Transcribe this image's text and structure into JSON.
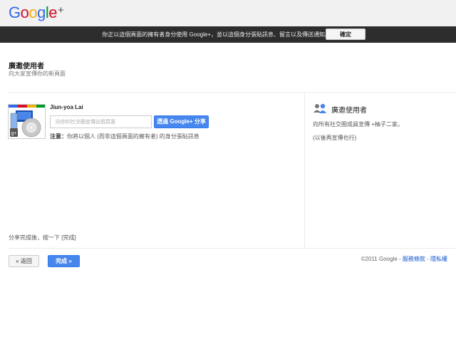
{
  "header": {
    "logo_text": "Google",
    "logo_plus": "+"
  },
  "notice": {
    "text": "你正以這個頁面的擁有者身分使用 Google+，並以這個身分張貼訊息、留言以及傳送通知。",
    "ok_label": "確定"
  },
  "page": {
    "title": "廣邀使用者",
    "subtitle": "向大家宣傳你的新頁面"
  },
  "share": {
    "page_name": "Jiun-yoa Lai",
    "input_placeholder": "向你的社交圈宣傳這個頁面",
    "button_label": "透過 Google+ 分享",
    "note_label": "注意：",
    "note_text": "你將以個人 (而非這個頁面的擁有者) 的身分張貼訊息",
    "after_share": "分享完成後，按一下 [完成]"
  },
  "sidebar": {
    "title": "廣邀使用者",
    "line1": "向所有社交圈成員宣傳 +柚子二家。",
    "line2": "(以後再宣傳也行)"
  },
  "actions": {
    "back_label": "« 返回",
    "done_label": "完成 »"
  },
  "footer": {
    "copyright": "©2011 Google",
    "sep1": " - ",
    "terms": "服務條款",
    "sep2": " - ",
    "privacy": "隱私權"
  },
  "colors": {
    "google_blue": "#3369e8",
    "google_red": "#d50f25",
    "google_yellow": "#eeb211",
    "google_green": "#009925",
    "primary_button": "#4787ed",
    "notice_bar": "#2d2d2d"
  }
}
